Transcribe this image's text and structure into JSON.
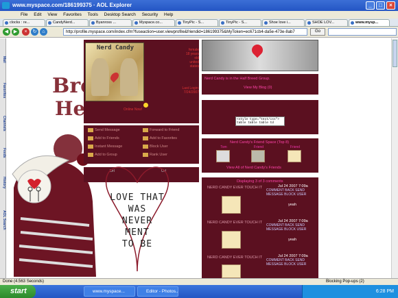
{
  "window": {
    "title": "www.myspace.com/186199375 · AOL Explorer"
  },
  "menu": [
    "File",
    "Edit",
    "View",
    "Favorites",
    "Tools",
    "Desktop Search",
    "Security",
    "Help"
  ],
  "tabs": [
    {
      "label": "clocks : re..."
    },
    {
      "label": "CandyNerd..."
    },
    {
      "label": "Byanross ..."
    },
    {
      "label": "Myspace.co..."
    },
    {
      "label": "TinyPic - S..."
    },
    {
      "label": "TinyPic - S..."
    },
    {
      "label": "Shoe love i..."
    },
    {
      "label": "SHOE LOV..."
    },
    {
      "label": "www.mysp..."
    }
  ],
  "address": {
    "url": "http://profile.myspace.com/index.cfm?fuseaction=user.viewprofile&friendid=186199375&MyToken=ec671cb4-da5e-473e-8ab7",
    "go": "Go"
  },
  "sidebar": [
    "Mail",
    "Favorites",
    "Channels",
    "Feeds",
    "History",
    "AOL Search"
  ],
  "profile": {
    "name_art": "Nerd Candy",
    "brand_word_1": "Bro",
    "brand_word_2": "Heart",
    "online": "Online Now!",
    "stats_right": [
      "female",
      "18 years",
      "old",
      "united",
      "states"
    ],
    "last_login": "Last Login: 7/24/2007",
    "link_rows": [
      [
        "Send Message",
        "Forward to Friend"
      ],
      [
        "Add to Friends",
        "Add to Favorites"
      ],
      [
        "Instant Message",
        "Block User"
      ],
      [
        "Add to Group",
        "Rank User"
      ]
    ],
    "url_label": "Url",
    "url_value": "Url",
    "poster": [
      "LOVE THAT",
      "WAS",
      "NEVER",
      "MENT",
      "TO BE"
    ],
    "blog_header": "Nerd Candy is in the Half Breed Group.",
    "blog_sub": "View My Blog (0)",
    "blurb_code": "<style type=\"text/css\"> table table table td",
    "friends_header": "Nerd Candy's Friend Space (Top 8)",
    "friends_names": [
      "Tom",
      "Friend",
      "Friend"
    ],
    "friends_footer": "View All of Nerd Candy's Friends",
    "comments_header": "Displaying 3 of 3 comments",
    "comment_name": "NERD CANDY EVER TOUCH IT",
    "comment_date": "Jul 24 2007 7:09a",
    "comment_links": [
      "COMMENT BACK",
      "SEND MESSAGE",
      "BLOCK USER"
    ],
    "comment_body": "yeah"
  },
  "status": {
    "text": "Done (4.563 Seconds)",
    "popups": "Blocking Pop-ups (2)"
  },
  "taskbar": {
    "start": "start",
    "items": [
      "www.myspace...",
      "Editor - Photos..."
    ],
    "clock": "6:28 PM"
  }
}
